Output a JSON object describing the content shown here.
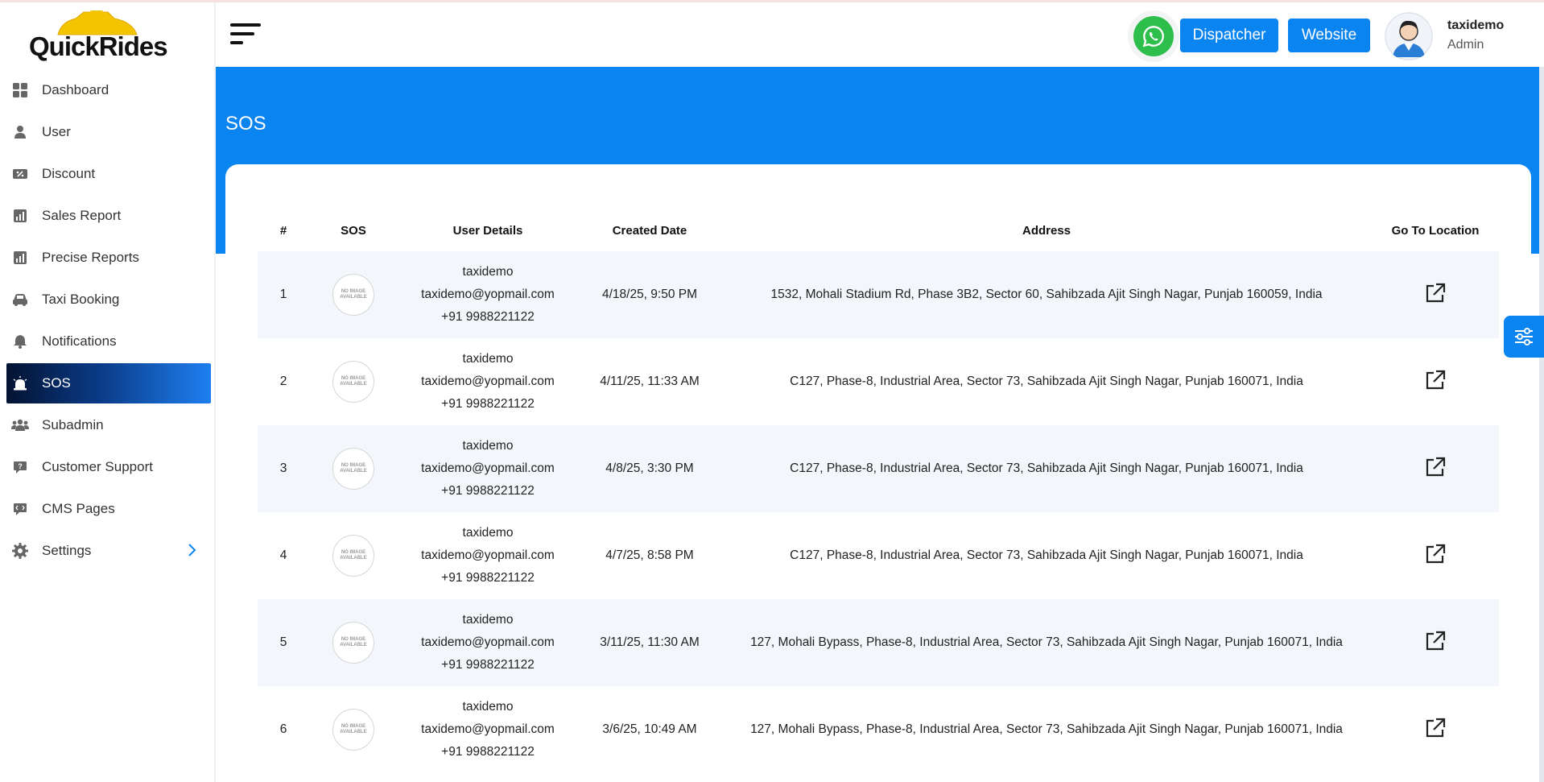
{
  "app": {
    "logo_text": "QuickRides"
  },
  "sidebar": {
    "items": [
      {
        "label": "Dashboard",
        "icon": "dashboard-icon"
      },
      {
        "label": "User",
        "icon": "user-icon"
      },
      {
        "label": "Discount",
        "icon": "discount-icon"
      },
      {
        "label": "Sales Report",
        "icon": "chart-icon"
      },
      {
        "label": "Precise Reports",
        "icon": "chart-icon"
      },
      {
        "label": "Taxi Booking",
        "icon": "taxi-icon"
      },
      {
        "label": "Notifications",
        "icon": "bell-icon"
      },
      {
        "label": "SOS",
        "icon": "siren-icon",
        "active": true
      },
      {
        "label": "Subadmin",
        "icon": "users-icon"
      },
      {
        "label": "Customer Support",
        "icon": "support-icon"
      },
      {
        "label": "CMS Pages",
        "icon": "code-chat-icon"
      },
      {
        "label": "Settings",
        "icon": "gear-icon",
        "has_submenu": true
      }
    ]
  },
  "header": {
    "dispatcher_label": "Dispatcher",
    "website_label": "Website",
    "user_name": "taxidemo",
    "user_role": "Admin"
  },
  "page": {
    "title": "SOS"
  },
  "table": {
    "columns": [
      "#",
      "SOS",
      "User Details",
      "Created Date",
      "Address",
      "Go To Location"
    ],
    "no_image_text": "NO IMAGE AVAILABLE",
    "rows": [
      {
        "num": "1",
        "name": "taxidemo",
        "email": "taxidemo@yopmail.com",
        "phone": "+91 9988221122",
        "date": "4/18/25, 9:50 PM",
        "address": "1532, Mohali Stadium Rd, Phase 3B2, Sector 60, Sahibzada Ajit Singh Nagar, Punjab 160059, India"
      },
      {
        "num": "2",
        "name": "taxidemo",
        "email": "taxidemo@yopmail.com",
        "phone": "+91 9988221122",
        "date": "4/11/25, 11:33 AM",
        "address": "C127, Phase-8, Industrial Area, Sector 73, Sahibzada Ajit Singh Nagar, Punjab 160071, India"
      },
      {
        "num": "3",
        "name": "taxidemo",
        "email": "taxidemo@yopmail.com",
        "phone": "+91 9988221122",
        "date": "4/8/25, 3:30 PM",
        "address": "C127, Phase-8, Industrial Area, Sector 73, Sahibzada Ajit Singh Nagar, Punjab 160071, India"
      },
      {
        "num": "4",
        "name": "taxidemo",
        "email": "taxidemo@yopmail.com",
        "phone": "+91 9988221122",
        "date": "4/7/25, 8:58 PM",
        "address": "C127, Phase-8, Industrial Area, Sector 73, Sahibzada Ajit Singh Nagar, Punjab 160071, India"
      },
      {
        "num": "5",
        "name": "taxidemo",
        "email": "taxidemo@yopmail.com",
        "phone": "+91 9988221122",
        "date": "3/11/25, 11:30 AM",
        "address": "127, Mohali Bypass, Phase-8, Industrial Area, Sector 73, Sahibzada Ajit Singh Nagar, Punjab 160071, India"
      },
      {
        "num": "6",
        "name": "taxidemo",
        "email": "taxidemo@yopmail.com",
        "phone": "+91 9988221122",
        "date": "3/6/25, 10:49 AM",
        "address": "127, Mohali Bypass, Phase-8, Industrial Area, Sector 73, Sahibzada Ajit Singh Nagar, Punjab 160071, India"
      }
    ]
  },
  "colors": {
    "primary": "#0a84f0",
    "whatsapp": "#2dbe4b",
    "row_stripe": "#f3f6fa"
  }
}
